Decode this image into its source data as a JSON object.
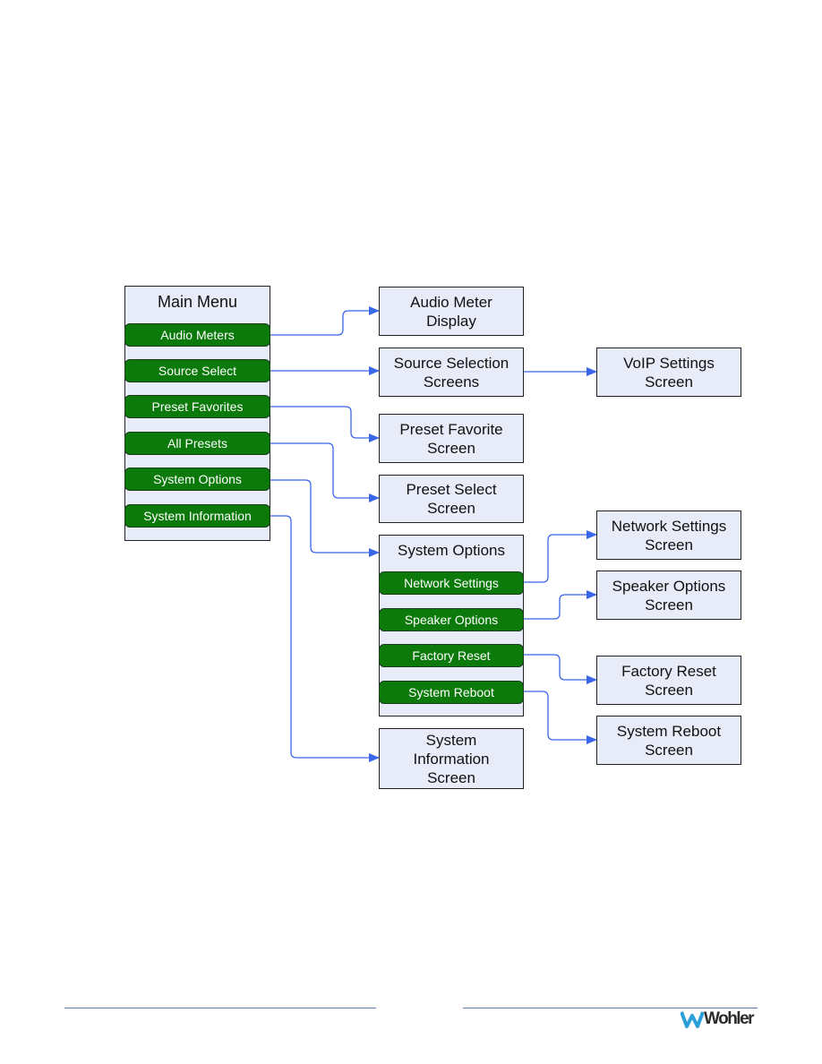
{
  "main_menu": {
    "title": "Main Menu",
    "items": [
      "Audio Meters",
      "Source Select",
      "Preset Favorites",
      "All Presets",
      "System Options",
      "System Information"
    ]
  },
  "screens": {
    "audio_meter": "Audio Meter Display",
    "source_selection": "Source Selection Screens",
    "voip": "VoIP Settings Screen",
    "preset_favorite": "Preset Favorite Screen",
    "preset_select": "Preset Select Screen",
    "system_information": "System Information Screen",
    "network": "Network Settings Screen",
    "speaker": "Speaker Options Screen",
    "factory": "Factory Reset Screen",
    "reboot": "System Reboot Screen"
  },
  "system_options_menu": {
    "title": "System Options",
    "items": [
      "Network Settings",
      "Speaker Options",
      "Factory Reset",
      "System Reboot"
    ]
  },
  "footer": {
    "logo": "Wohler"
  },
  "colors": {
    "button": "#0b7a0b",
    "box": "#e8ecf8",
    "connector": "#3a66e8",
    "rule": "#5b7bb5"
  }
}
